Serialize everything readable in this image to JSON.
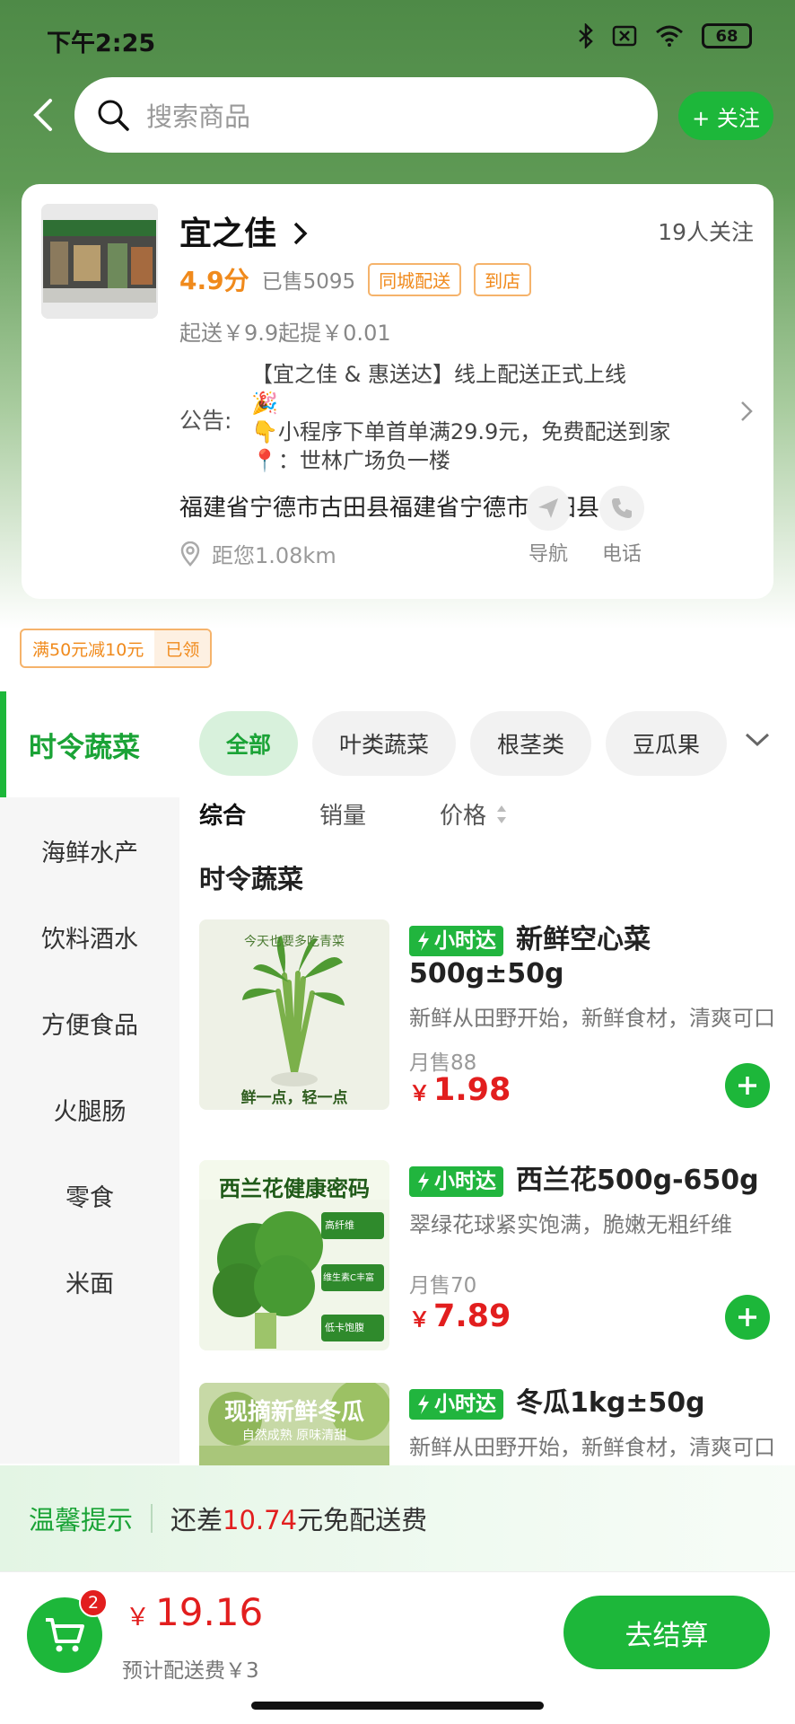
{
  "status": {
    "time": "下午2:25",
    "battery": "68"
  },
  "search": {
    "placeholder": "搜索商品"
  },
  "follow": {
    "label": "+ 关注"
  },
  "store": {
    "name": "宜之佳",
    "followers": "19人关注",
    "rating": "4.9分",
    "sold": "已售5095",
    "tags": [
      "同城配送",
      "到店"
    ],
    "min_order": "起送￥9.9起提￥0.01",
    "notice_label": "公告:",
    "notice_lines": [
      "【宜之佳 & 惠送达】线上配送正式上线",
      "🎉",
      "👇小程序下单首单满29.9元，免费配送到家📍：世林广场负一楼"
    ],
    "address": "福建省宁德市古田县福建省宁德市古田县",
    "distance": "距您1.08km",
    "nav_label": "导航",
    "phone_label": "电话"
  },
  "coupon": {
    "text": "满50元减10元",
    "status": "已领"
  },
  "sidebar": {
    "active": "时令蔬菜",
    "items": [
      "海鲜水产",
      "饮料酒水",
      "方便食品",
      "火腿肠",
      "零食",
      "米面"
    ]
  },
  "chips": [
    "全部",
    "叶类蔬菜",
    "根茎类",
    "豆瓜果"
  ],
  "sorts": {
    "comprehensive": "综合",
    "sales": "销量",
    "price": "价格"
  },
  "section_title": "时令蔬菜",
  "products": [
    {
      "badge": "小时达",
      "name": "新鲜空心菜500g±50g",
      "desc": "新鲜从田野开始，新鲜食材，清爽可口",
      "sold": "月售88",
      "currency": "￥",
      "price": "1.98",
      "img_top": "今天也要多吃青菜",
      "img_bottom": "鲜一点，轻一点"
    },
    {
      "badge": "小时达",
      "name": "西兰花500g-650g",
      "desc": "翠绿花球紧实饱满，脆嫩无粗纤维",
      "sold": "月售70",
      "currency": "￥",
      "price": "7.89",
      "img_title": "西兰花健康密码",
      "img_tags": [
        "高纤维",
        "维生素C丰富",
        "低卡饱腹"
      ]
    },
    {
      "badge": "小时达",
      "name": "冬瓜1kg±50g",
      "desc": "新鲜从田野开始，新鲜食材，清爽可口",
      "img_title": "现摘新鲜冬瓜",
      "img_sub": "自然成熟 原味清甜"
    }
  ],
  "tip": {
    "label": "温馨提示",
    "prefix": "还差",
    "amount": "10.74",
    "suffix": "元免配送费"
  },
  "cart": {
    "count": "2",
    "currency": "￥",
    "total": "19.16",
    "delivery_fee": "预计配送费￥3",
    "checkout": "去结算"
  },
  "colors": {
    "brand_green": "#1db73a",
    "price_red": "#e21e1e",
    "accent_orange": "#f08a1c"
  }
}
